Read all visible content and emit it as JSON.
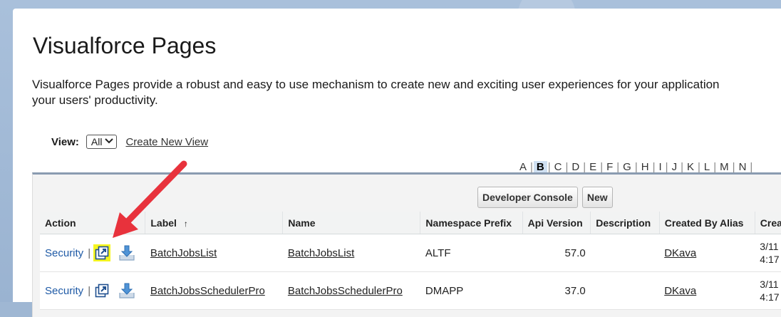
{
  "page": {
    "title": "Visualforce Pages",
    "description_line1": "Visualforce Pages provide a robust and easy to use mechanism to create new and exciting user experiences for your application",
    "description_line2": "your users' productivity."
  },
  "view": {
    "label": "View:",
    "selected": "All",
    "create_link": "Create New View"
  },
  "alphabet": {
    "letters": [
      "A",
      "B",
      "C",
      "D",
      "E",
      "F",
      "G",
      "H",
      "I",
      "J",
      "K",
      "L",
      "M",
      "N"
    ],
    "active": "B"
  },
  "buttons": {
    "developer_console": "Developer Console",
    "new": "New"
  },
  "table": {
    "headers": {
      "action": "Action",
      "label": "Label",
      "label_sort": "↑",
      "name": "Name",
      "namespace": "Namespace Prefix",
      "api": "Api Version",
      "description": "Description",
      "created_by": "Created By Alias",
      "created_date": "Crea"
    },
    "rows": [
      {
        "action_label": "Security",
        "pipe": "|",
        "label": "BatchJobsList",
        "name": "BatchJobsList",
        "namespace": "ALTF",
        "api": "57.0",
        "description": "",
        "created_by": "DKava",
        "created_line1": "3/11",
        "created_line2": "4:17"
      },
      {
        "action_label": "Security",
        "pipe": "|",
        "label": "BatchJobsSchedulerPro",
        "name": "BatchJobsSchedulerPro",
        "namespace": "DMAPP",
        "api": "37.0",
        "description": "",
        "created_by": "DKava",
        "created_line1": "3/11",
        "created_line2": "4:17"
      }
    ]
  },
  "colors": {
    "link": "#1f5aa6",
    "highlight": "#f5f51e",
    "arrow": "#e8323c"
  },
  "icons": {
    "open": "open-in-new-window-icon",
    "download": "download-icon",
    "dropdown": "chevron-down-icon",
    "annotation": "red-arrow-icon"
  }
}
